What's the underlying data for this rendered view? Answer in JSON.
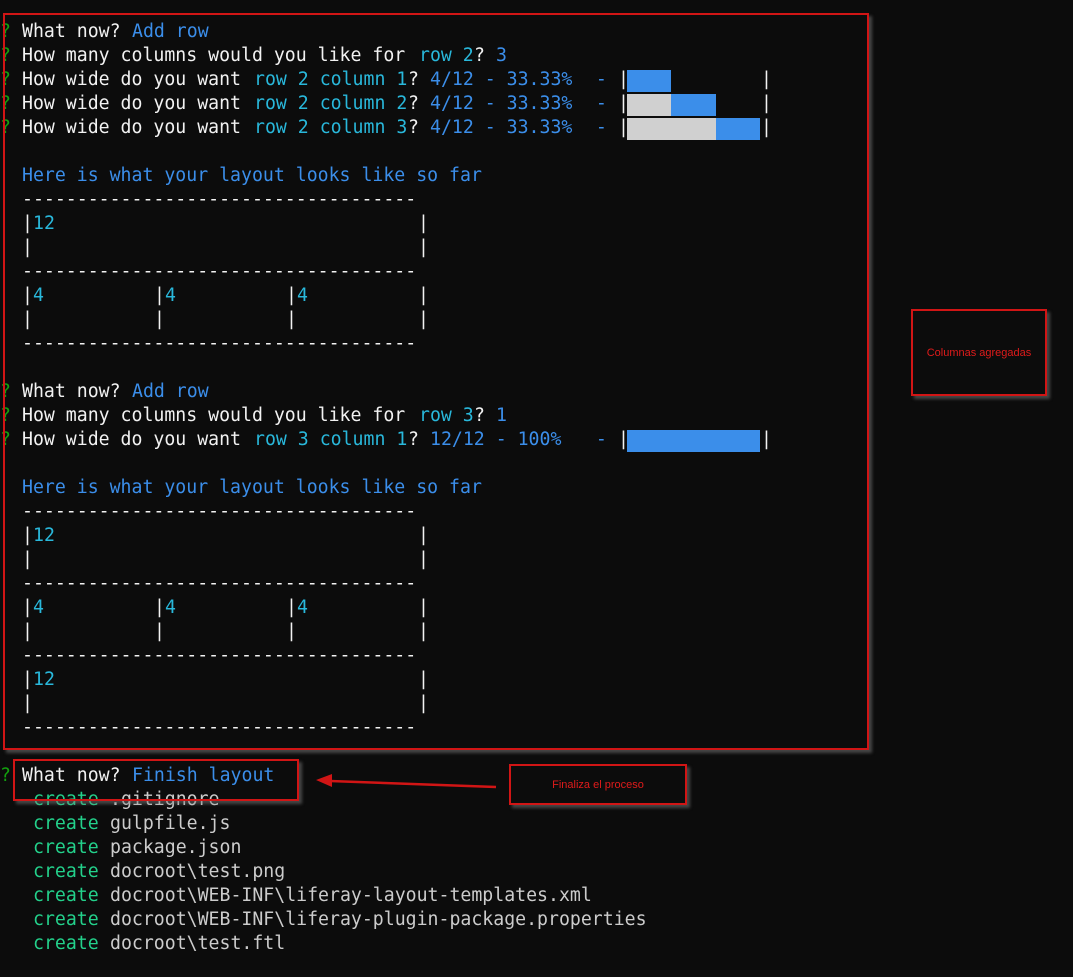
{
  "colors": {
    "fill": "#3b8eea",
    "empty": "#d0d0d0",
    "annotation": "#d11515"
  },
  "prompt": {
    "mark": "?",
    "what_now": "What now?",
    "add_row": "Add row",
    "finish": "Finish layout",
    "cols_q": "How many columns would you like for",
    "wide_q": "How wide do you want",
    "qmark": "?",
    "sep": "  -",
    "bar": "|"
  },
  "prompts": {
    "r2_count": {
      "row": "row 2",
      "value": "3"
    },
    "r2c1": {
      "target": "row 2 column 1",
      "value": "4/12 - 33.33%"
    },
    "r2c2": {
      "target": "row 2 column 2",
      "value": "4/12 - 33.33%"
    },
    "r2c3": {
      "target": "row 2 column 3",
      "value": "4/12 - 33.33%"
    },
    "r3_count": {
      "row": "row 3",
      "value": "1"
    },
    "r3c1": {
      "target": "row 3 column 1",
      "value": "12/12 - 100%"
    }
  },
  "width_bars": [
    {
      "filled_from": 0,
      "filled_to": 0.3333
    },
    {
      "filled_from": 0.3333,
      "filled_to": 0.6667
    },
    {
      "filled_from": 0.6667,
      "filled_to": 1
    },
    {
      "filled_from": 0,
      "filled_to": 1
    }
  ],
  "layout_heading": "Here is what your layout looks like so far",
  "layout_preview": {
    "dash_line": "------------------------------------",
    "row_12_top": "|            |",
    "row_12_label": "12",
    "row_empty": "|                                   |",
    "row_4_top": "|           |           |           |",
    "row_4_empty": "|           |           |           |",
    "col_4": "4"
  },
  "files": {
    "verb": "create",
    "list": [
      ".gitignore",
      "gulpfile.js",
      "package.json",
      "docroot\\test.png",
      "docroot\\WEB-INF\\liferay-layout-templates.xml",
      "docroot\\WEB-INF\\liferay-plugin-package.properties",
      "docroot\\test.ftl"
    ]
  },
  "annotations": {
    "columns": "Columnas agregadas",
    "finish": "Finaliza el proceso"
  }
}
